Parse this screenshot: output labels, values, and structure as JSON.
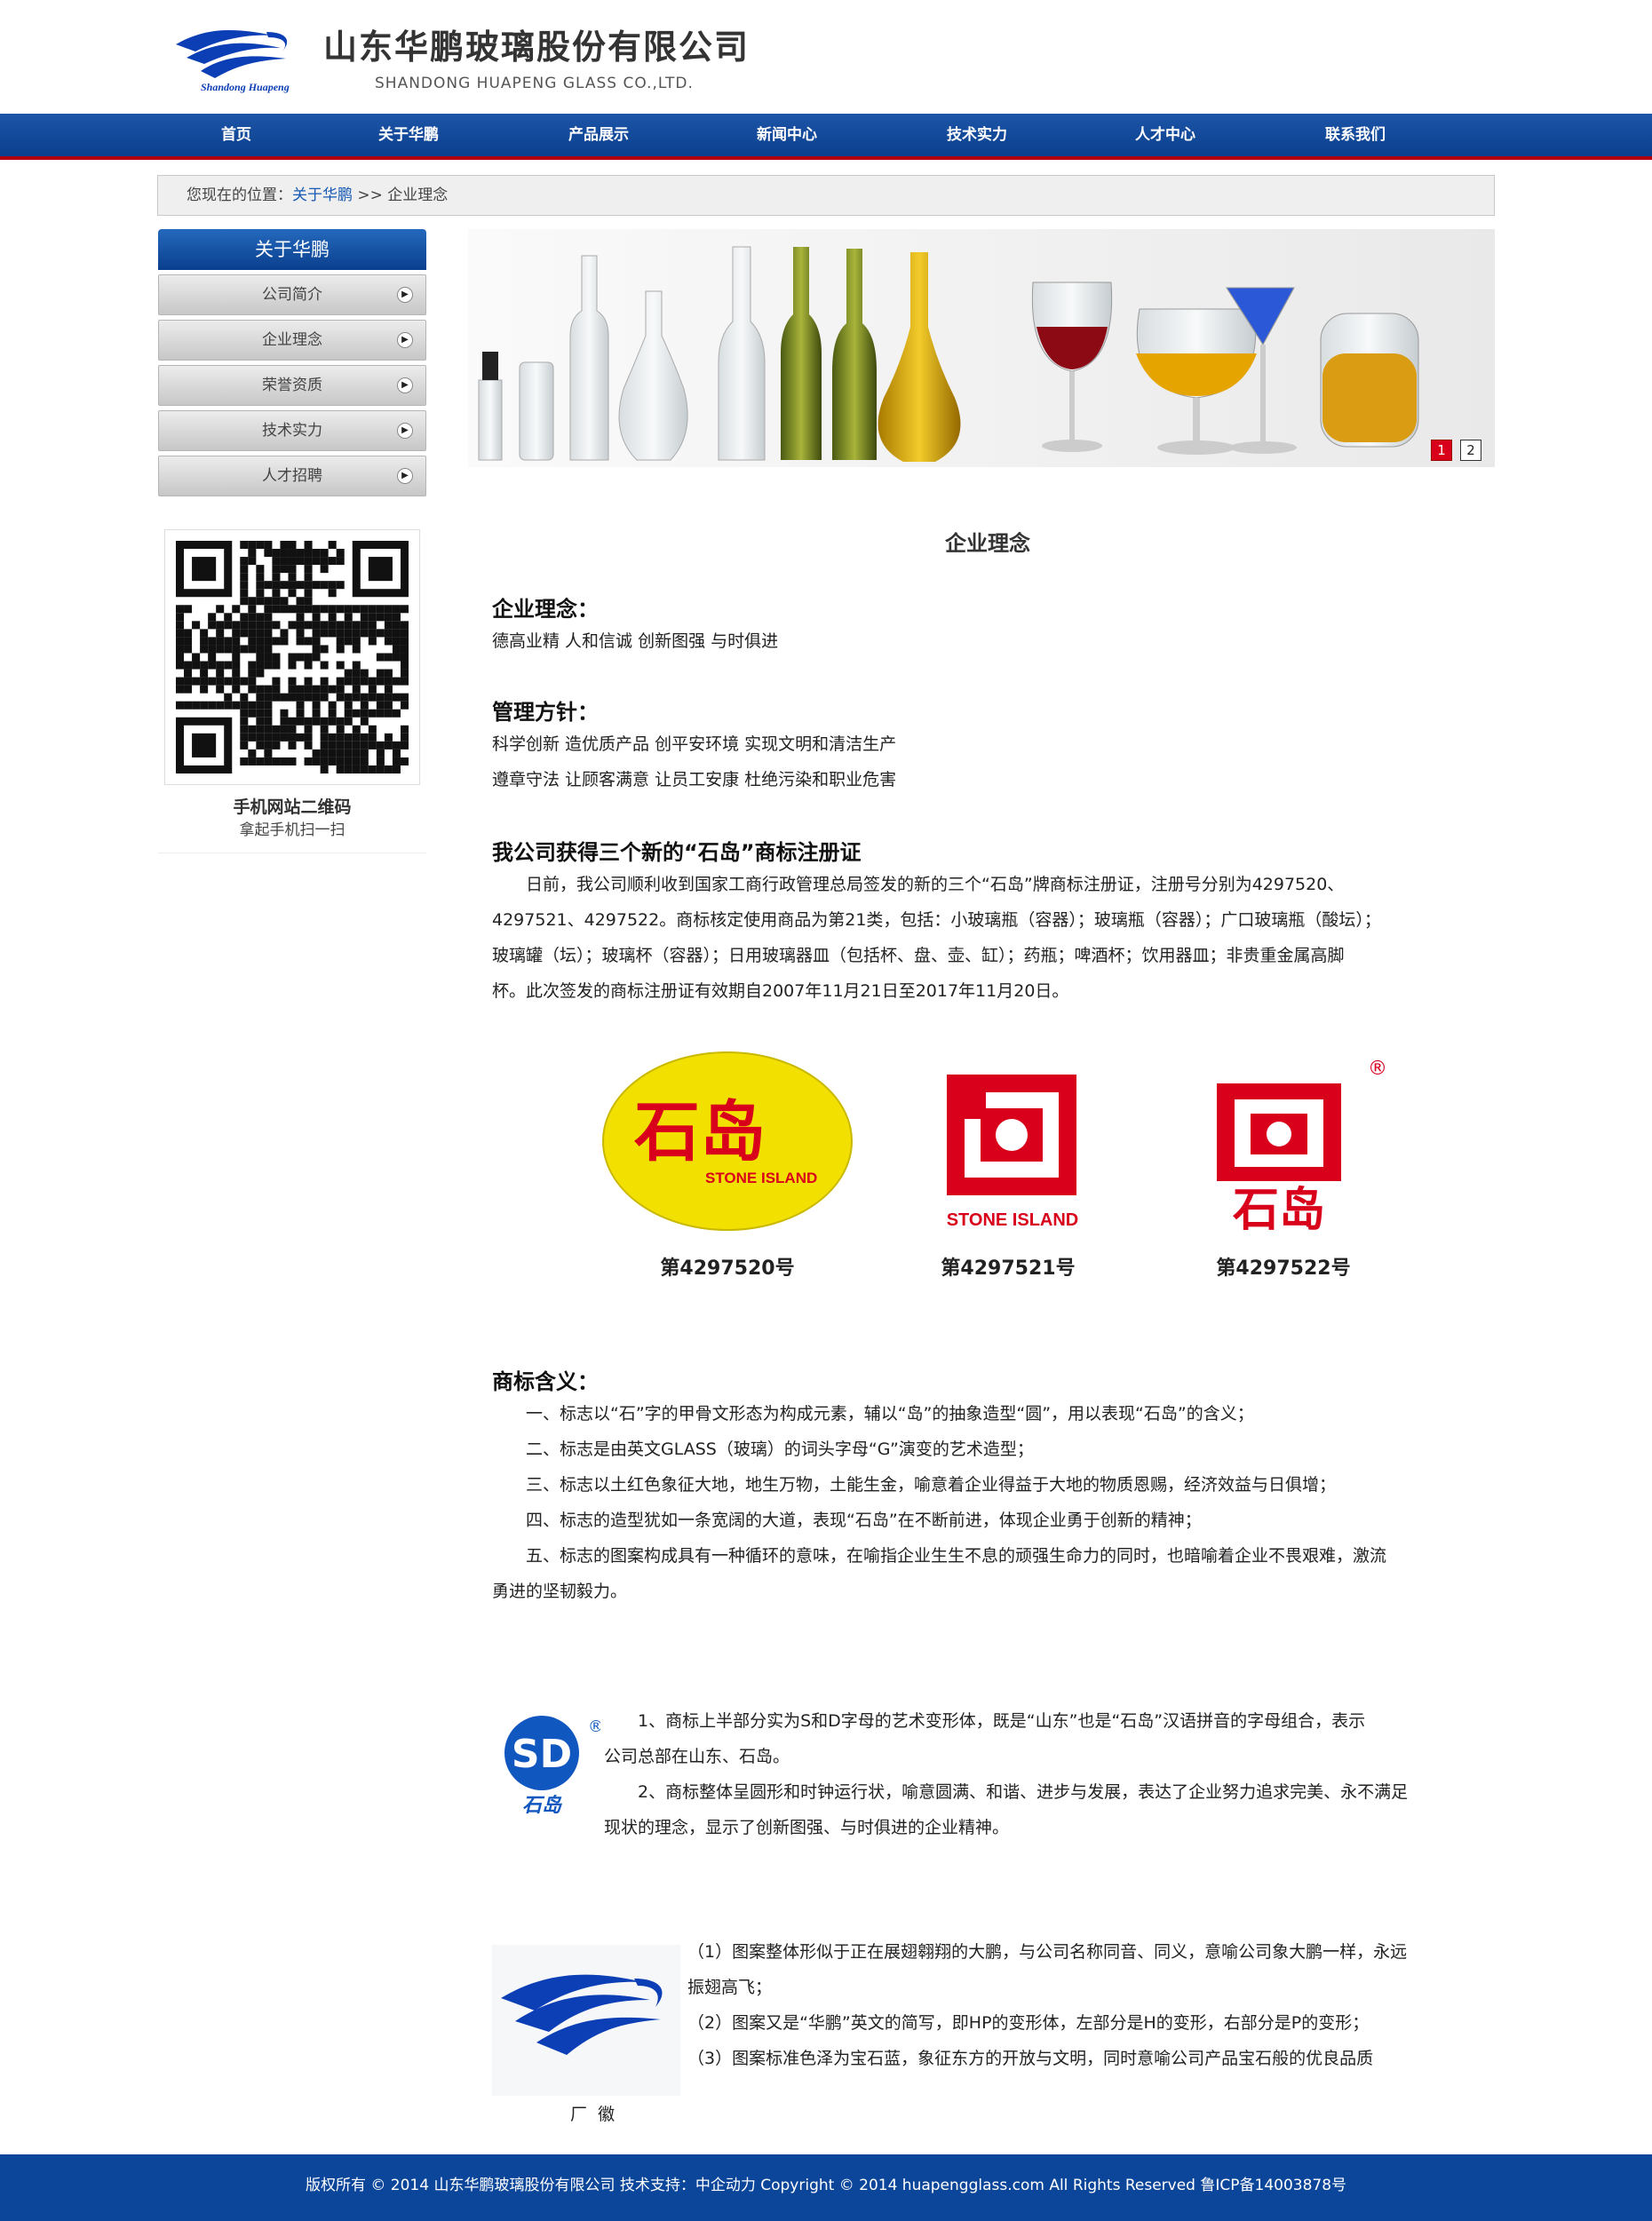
{
  "header": {
    "company_cn": "山东华鹏玻璃股份有限公司",
    "company_en": "SHANDONG HUAPENG GLASS CO.,LTD.",
    "logo_text": "Shandong Huapeng"
  },
  "nav": {
    "items": [
      {
        "label": "首页"
      },
      {
        "label": "关于华鹏"
      },
      {
        "label": "产品展示"
      },
      {
        "label": "新闻中心"
      },
      {
        "label": "技术实力"
      },
      {
        "label": "人才中心"
      },
      {
        "label": "联系我们"
      }
    ]
  },
  "breadcrumb": {
    "prefix": "您现在的位置：",
    "link": "关于华鹏",
    "separator": " >> ",
    "current": "企业理念"
  },
  "sidebar": {
    "title": "关于华鹏",
    "items": [
      {
        "label": "公司简介"
      },
      {
        "label": "企业理念"
      },
      {
        "label": "荣誉资质"
      },
      {
        "label": "技术实力"
      },
      {
        "label": "人才招聘"
      }
    ],
    "qr_title": "手机网站二维码",
    "qr_subtitle": "拿起手机扫一扫"
  },
  "banner": {
    "pager": [
      "1",
      "2"
    ],
    "active_page": "1"
  },
  "content": {
    "page_title": "企业理念",
    "s1_heading": "企业理念：",
    "s1_text": "德高业精  人和信诚  创新图强  与时俱进",
    "s2_heading": "管理方针：",
    "s2_line1": "科学创新  造优质产品  创平安环境  实现文明和清洁生产",
    "s2_line2": "遵章守法  让顾客满意  让员工安康  杜绝污染和职业危害",
    "s3_heading": "我公司获得三个新的“石岛”商标注册证",
    "s3_para": [
      "　　日前，我公司顺利收到国家工商行政管理总局签发的新的三个“石岛”牌商标注册证，注册号分别为4297520、",
      "4297521、4297522。商标核定使用商品为第21类，包括：小玻璃瓶（容器）；玻璃瓶（容器）；广口玻璃瓶（酸坛）；",
      "玻璃罐（坛）；玻璃杯（容器）；日用玻璃器皿（包括杯、盘、壶、缸）；药瓶；啤酒杯；饮用器皿；非贵重金属高脚",
      "杯。此次签发的商标注册证有效期自2007年11月21日至2017年11月20日。"
    ],
    "trademarks": [
      {
        "number": "第4297520号",
        "cn": "石岛",
        "en": "STONE ISLAND"
      },
      {
        "number": "第4297521号",
        "en": "STONE ISLAND"
      },
      {
        "number": "第4297522号",
        "cn": "石岛"
      }
    ],
    "s4_heading": "商标含义：",
    "s4_lines": [
      "　　一、标志以“石”字的甲骨文形态为构成元素，辅以“岛”的抽象造型“圆”，用以表现“石岛”的含义；",
      "　　二、标志是由英文GLASS（玻璃）的词头字母“G”演变的艺术造型；",
      "　　三、标志以土红色象征大地，地生万物，土能生金，喻意着企业得益于大地的物质恩赐，经济效益与日俱增；",
      "　　四、标志的造型犹如一条宽阔的大道，表现“石岛”在不断前进，体现企业勇于创新的精神；",
      "　　五、标志的图案构成具有一种循环的意味，在喻指企业生生不息的顽强生命力的同时，也暗喻着企业不畏艰难，激流",
      "勇进的坚韧毅力。"
    ],
    "sd_logo_text": "石岛",
    "sd_lines": [
      "　　1、商标上半部分实为S和D字母的艺术变形体，既是“山东”也是“石岛”汉语拼音的字母组合，表示",
      "公司总部在山东、石岛。",
      "　　2、商标整体呈圆形和时钟运行状，喻意圆满、和谐、进步与发展，表达了企业努力追求完美、永不满足",
      "现状的理念，显示了创新图强、与时俱进的企业精神。"
    ],
    "hp_logo_caption": "厂  徽",
    "hp_lines": [
      "（1）图案整体形似于正在展翅翱翔的大鹏，与公司名称同音、同义，意喻公司象大鹏一样，永远",
      "振翅高飞；",
      "（2）图案又是“华鹏”英文的简写，即HP的变形体，左部分是H的变形，右部分是P的变形；",
      "（3）图案标准色泽为宝石蓝，象征东方的开放与文明，同时意喻公司产品宝石般的优良品质"
    ]
  },
  "footer": {
    "text": "版权所有 © 2014 山东华鹏玻璃股份有限公司 技术支持：中企动力 Copyright © 2014 huapengglass.com All Rights Reserved  鲁ICP备14003878号"
  },
  "colors": {
    "nav_blue": "#0b469a",
    "accent_red": "#b3000e",
    "trademark_red": "#d8001a",
    "trademark_yellow": "#f2e000",
    "logo_blue": "#0c3fb5"
  }
}
